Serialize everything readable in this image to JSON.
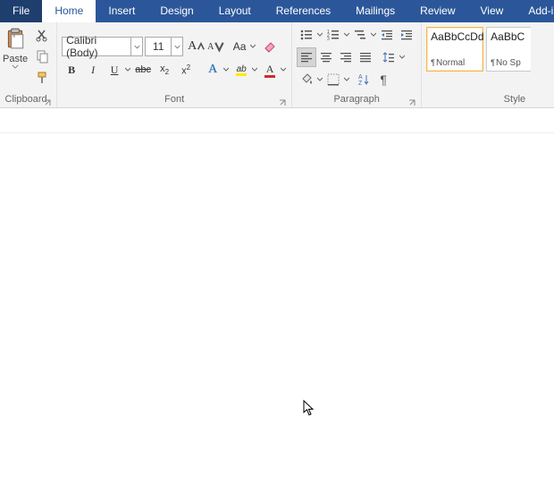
{
  "tabs": {
    "file": "File",
    "home": "Home",
    "insert": "Insert",
    "design": "Design",
    "layout": "Layout",
    "references": "References",
    "mailings": "Mailings",
    "review": "Review",
    "view": "View",
    "addins": "Add-ins"
  },
  "clipboard": {
    "paste": "Paste",
    "label": "Clipboard"
  },
  "font": {
    "name": "Calibri (Body)",
    "size": "11",
    "label": "Font",
    "case": "Aa",
    "grow": "A",
    "shrink": "A",
    "clear": "",
    "bold": "B",
    "italic": "I",
    "underline": "U",
    "strike": "abc",
    "sub": "x",
    "sup": "x",
    "sub2": "2",
    "sup2": "2"
  },
  "paragraph": {
    "label": "Paragraph"
  },
  "styles": {
    "label": "Style",
    "items": [
      {
        "sample": "AaBbCcDd",
        "name": "Normal"
      },
      {
        "sample": "AaBbC",
        "name": "No Sp"
      }
    ]
  }
}
